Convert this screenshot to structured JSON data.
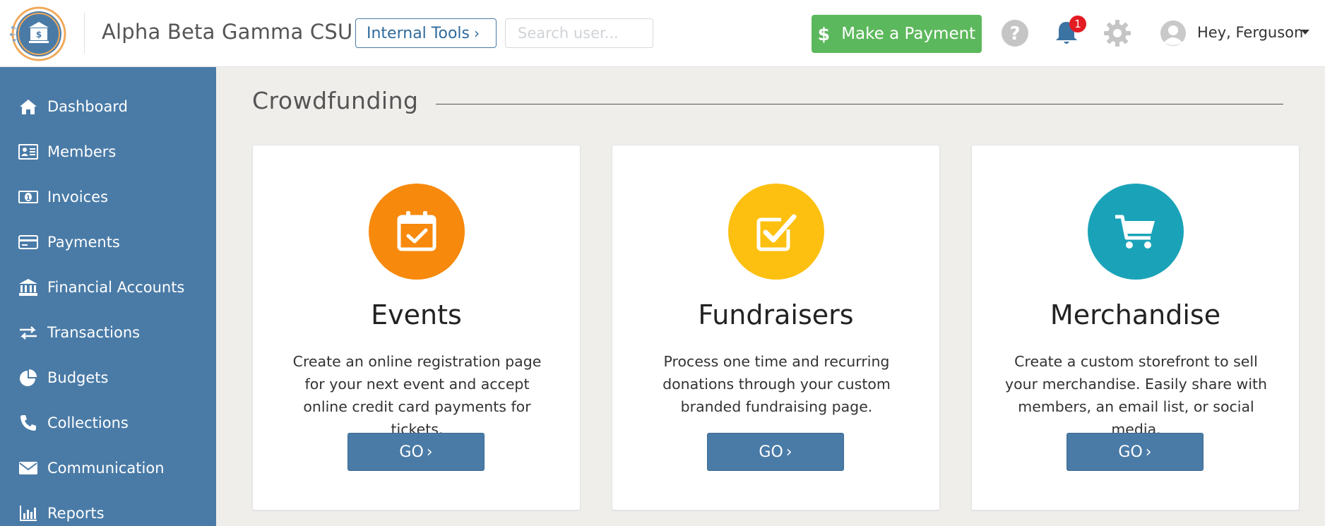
{
  "header": {
    "org_name": "Alpha Beta Gamma CSU",
    "internal_tools_label": "Internal Tools",
    "search_placeholder": "Search user...",
    "make_payment_label": "Make a Payment",
    "notification_count": "1",
    "user_greeting": "Hey, Ferguson"
  },
  "sidebar": {
    "items": [
      {
        "label": "Dashboard",
        "icon": "home-icon"
      },
      {
        "label": "Members",
        "icon": "id-card-icon"
      },
      {
        "label": "Invoices",
        "icon": "money-bill-icon"
      },
      {
        "label": "Payments",
        "icon": "credit-card-icon"
      },
      {
        "label": "Financial Accounts",
        "icon": "bank-icon"
      },
      {
        "label": "Transactions",
        "icon": "exchange-icon"
      },
      {
        "label": "Budgets",
        "icon": "pie-chart-icon"
      },
      {
        "label": "Collections",
        "icon": "phone-icon"
      },
      {
        "label": "Communication",
        "icon": "envelope-icon"
      },
      {
        "label": "Reports",
        "icon": "bar-chart-icon"
      }
    ]
  },
  "main": {
    "section_title": "Crowdfunding",
    "cards": [
      {
        "title": "Events",
        "description": "Create an online registration page for your next event and accept online credit card payments for tickets.",
        "button_label": "GO",
        "icon": "calendar-check-icon",
        "color": "#f7890c"
      },
      {
        "title": "Fundraisers",
        "description": "Process one time and recurring donations through your custom branded fundraising page.",
        "button_label": "GO",
        "icon": "check-square-icon",
        "color": "#fdc010"
      },
      {
        "title": "Merchandise",
        "description": "Create a custom storefront to sell your merchandise. Easily share with members, an email list, or social media.",
        "button_label": "GO",
        "icon": "shopping-cart-icon",
        "color": "#1aa3b8"
      }
    ]
  },
  "colors": {
    "sidebar": "#4a7ba7",
    "primary": "#4a7ba7",
    "success": "#5cb85c",
    "background": "#efeeeb"
  }
}
